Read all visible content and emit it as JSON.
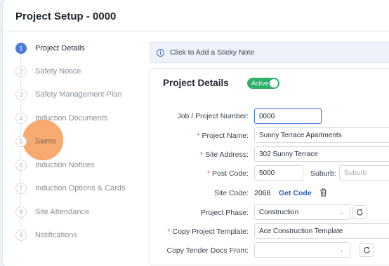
{
  "page": {
    "title": "Project Setup - 0000"
  },
  "steps": [
    {
      "num": "1",
      "label": "Project Details",
      "active": true
    },
    {
      "num": "2",
      "label": "Safety Notice"
    },
    {
      "num": "3",
      "label": "Safety Management Plan"
    },
    {
      "num": "4",
      "label": "Induction Documents"
    },
    {
      "num": "5",
      "label": "Swms"
    },
    {
      "num": "6",
      "label": "Induction Notices"
    },
    {
      "num": "7",
      "label": "Induction Options & Cards"
    },
    {
      "num": "8",
      "label": "Site Attendance"
    },
    {
      "num": "9",
      "label": "Notifications"
    }
  ],
  "sticky": {
    "icon": "info-icon",
    "text": "Click to Add a Sticky Note"
  },
  "panel": {
    "title": "Project Details",
    "status": "Active"
  },
  "form": {
    "job_label": "Job / Project Number:",
    "job_value": "0000",
    "name_label": "Project Name:",
    "name_value": "Sunny Terrace Apartments",
    "address_label": "Site Address:",
    "address_value": "302 Sunny Terrace",
    "post_label": "Post Code:",
    "post_value": "5000",
    "suburb_label": "Suburb:",
    "suburb_placeholder": "Suburb",
    "sitecode_label": "Site Code:",
    "sitecode_value": "2068",
    "get_code": "Get Code",
    "phase_label": "Project Phase:",
    "phase_value": "Construction",
    "template_label": "Copy Project Template:",
    "template_value": "Ace Construction Template",
    "tender_label": "Copy Tender Docs From:",
    "tender_value": ""
  },
  "colors": {
    "accent": "#4a7be0",
    "active_toggle": "#2eaf6a",
    "highlight": "#f59448",
    "required": "#e0484e"
  }
}
